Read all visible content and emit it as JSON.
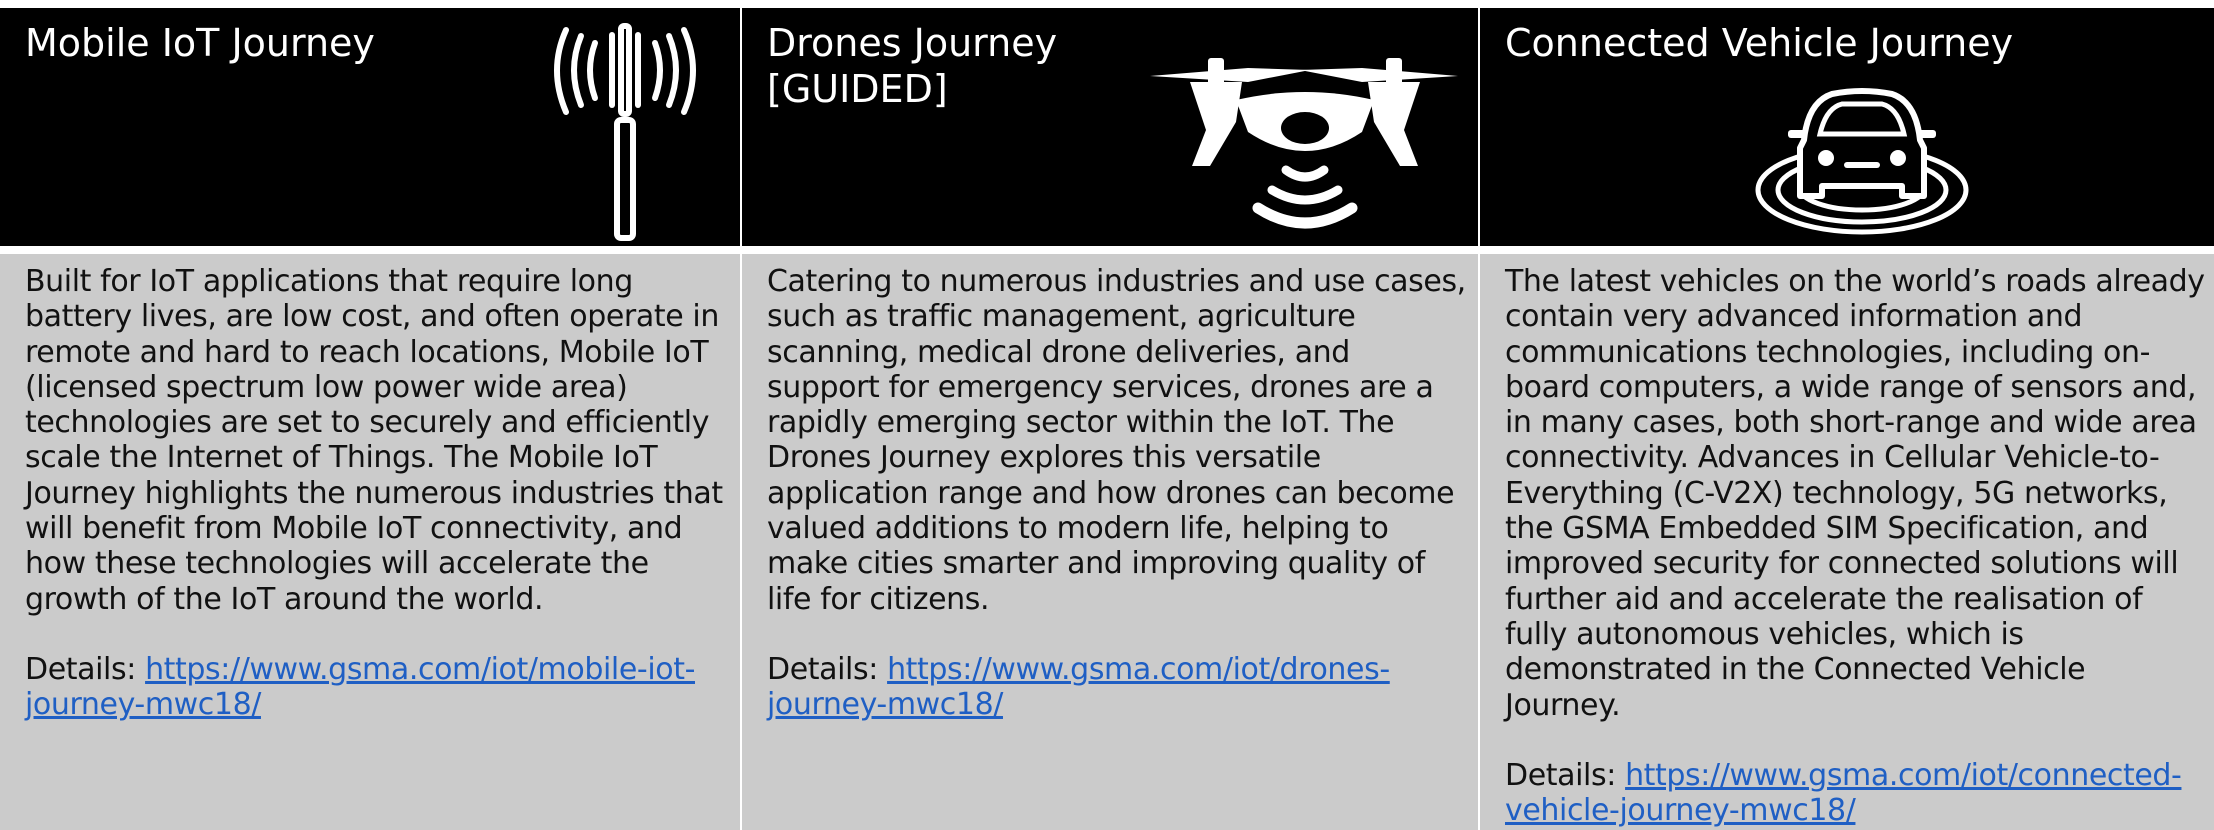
{
  "cards": [
    {
      "title": "Mobile IoT Journey",
      "icon": "cell-tower-icon",
      "description": "Built for IoT applications that require long battery lives, are low cost, and often operate in remote and hard to reach locations, Mobile IoT (licensed spectrum low power wide area) technologies are set to securely and efficiently scale the Internet of Things. The Mobile IoT Journey highlights the numerous industries that will benefit from Mobile IoT connectivity, and how these technologies will accelerate the growth of the IoT around the world.",
      "details_label": "Details: ",
      "details_url": "https://www.gsma.com/iot/mobile-iot-journey-mwc18/"
    },
    {
      "title": "Drones Journey\n[GUIDED]",
      "icon": "drone-icon",
      "description": "Catering to numerous industries and use cases, such as traffic management, agriculture scanning, medical drone deliveries, and support for emergency services, drones are a rapidly emerging sector within the IoT. The Drones Journey explores this versatile application range and how drones can become valued additions to modern life, helping to make cities smarter and improving quality of life for citizens.",
      "details_label": "Details: ",
      "details_url": "https://www.gsma.com/iot/drones-journey-mwc18/"
    },
    {
      "title": "Connected Vehicle Journey",
      "icon": "connected-car-icon",
      "description": "The latest vehicles on the world’s roads already contain very advanced information and communications technologies, including on-board computers, a wide range of sensors and, in many cases, both short-range and wide area connectivity. Advances in Cellular Vehicle-to-Everything (C-V2X) technology, 5G networks, the GSMA Embedded SIM Specification, and improved security for connected solutions will further aid and accelerate the realisation of fully autonomous vehicles, which is demonstrated in the Connected Vehicle Journey.",
      "details_label": "Details: ",
      "details_url": "https://www.gsma.com/iot/connected-vehicle-journey-mwc18/"
    }
  ],
  "colors": {
    "header_bg": "#000000",
    "header_text": "#ffffff",
    "body_bg": "#cbcbcb",
    "link": "#1f5fc4"
  }
}
